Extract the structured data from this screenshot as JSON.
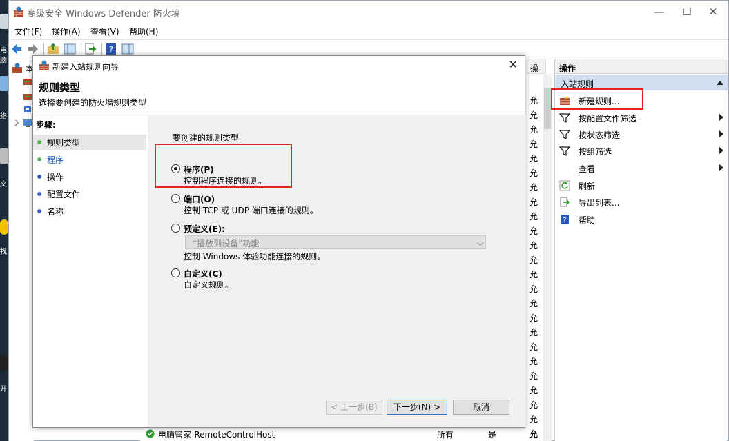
{
  "desktop": {
    "labels": [
      "电脑",
      "络",
      "文",
      "找",
      "开"
    ]
  },
  "main_window": {
    "title": "高级安全 Windows Defender 防火墙",
    "controls": {
      "minimize": "—",
      "maximize": "☐",
      "close": "✕"
    },
    "menu": [
      "文件(F)",
      "操作(A)",
      "查看(V)",
      "帮助(H)"
    ],
    "tree": {
      "root_label": "本"
    },
    "list": {
      "column_header": "操",
      "allow_value": "允",
      "bottom_row": {
        "name": "电脑管家-RemoteControlHost",
        "profile": "所有",
        "enabled": "是",
        "action": "允"
      }
    },
    "actions": {
      "header": "操作",
      "section": "入站规则",
      "items": [
        {
          "label": "新建规则...",
          "icon": "new-rule-icon",
          "submenu": false
        },
        {
          "label": "按配置文件筛选",
          "icon": "filter-icon",
          "submenu": true
        },
        {
          "label": "按状态筛选",
          "icon": "filter-icon",
          "submenu": true
        },
        {
          "label": "按组筛选",
          "icon": "filter-icon",
          "submenu": true
        },
        {
          "label": "查看",
          "icon": "",
          "submenu": true
        },
        {
          "label": "刷新",
          "icon": "refresh-icon",
          "submenu": false
        },
        {
          "label": "导出列表...",
          "icon": "export-icon",
          "submenu": false
        },
        {
          "label": "帮助",
          "icon": "help-icon",
          "submenu": false
        }
      ]
    }
  },
  "wizard": {
    "title": "新建入站规则向导",
    "header_title": "规则类型",
    "header_subtitle": "选择要创建的防火墙规则类型",
    "steps_title": "步骤:",
    "steps": [
      {
        "label": "规则类型",
        "color": "#5cb85c"
      },
      {
        "label": "程序",
        "color": "#5cb85c"
      },
      {
        "label": "操作",
        "color": "#3a5fcd"
      },
      {
        "label": "配置文件",
        "color": "#3a5fcd"
      },
      {
        "label": "名称",
        "color": "#3a5fcd"
      }
    ],
    "prompt": "要创建的规则类型",
    "options": [
      {
        "label": "程序(P)",
        "desc": "控制程序连接的规则。",
        "checked": true
      },
      {
        "label": "端口(O)",
        "desc": "控制 TCP 或 UDP 端口连接的规则。",
        "checked": false
      },
      {
        "label": "预定义(E):",
        "desc": "控制 Windows 体验功能连接的规则。",
        "checked": false
      },
      {
        "label": "自定义(C)",
        "desc": "自定义规则。",
        "checked": false
      }
    ],
    "predefined_select": "“播放到设备”功能",
    "buttons": {
      "back": "< 上一步(B)",
      "next": "下一步(N) >",
      "cancel": "取消"
    }
  },
  "colors": {
    "highlight": "#e5231d",
    "action_section_bg": "#cfdff0"
  }
}
